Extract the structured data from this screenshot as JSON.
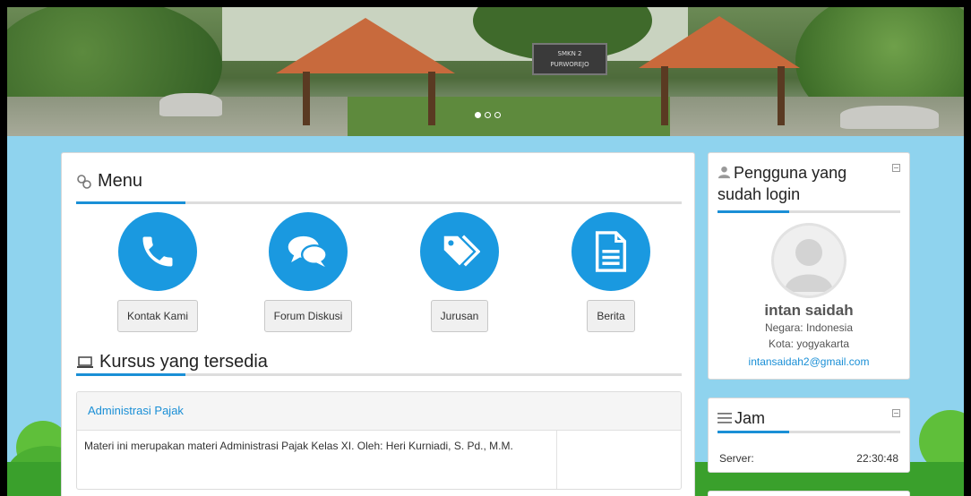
{
  "banner": {
    "sign_line1": "SMKN 2",
    "sign_line2": "PURWOREJO",
    "carousel_dots": 3,
    "carousel_active": 1
  },
  "menu": {
    "title": "Menu",
    "items": [
      {
        "label": "Kontak Kami",
        "icon": "phone-icon"
      },
      {
        "label": "Forum Diskusi",
        "icon": "chat-icon"
      },
      {
        "label": "Jurusan",
        "icon": "tags-icon"
      },
      {
        "label": "Berita",
        "icon": "document-icon"
      }
    ]
  },
  "courses": {
    "title": "Kursus yang tersedia",
    "items": [
      {
        "name": "Administrasi Pajak",
        "description": "Materi ini merupakan materi Administrasi Pajak Kelas XI. Oleh: Heri Kurniadi, S. Pd., M.M."
      }
    ]
  },
  "logged_in": {
    "title": "Pengguna yang sudah login",
    "user_name": "intan saidah",
    "country": "Negara: Indonesia",
    "city": "Kota: yogyakarta",
    "email": "intansaidah2@gmail.com"
  },
  "clock": {
    "title": "Jam",
    "label": "Server:",
    "time": "22:30:48"
  },
  "colors": {
    "accent": "#1a99e0",
    "background": "#8fd3ee",
    "link": "#1a8fd6"
  }
}
